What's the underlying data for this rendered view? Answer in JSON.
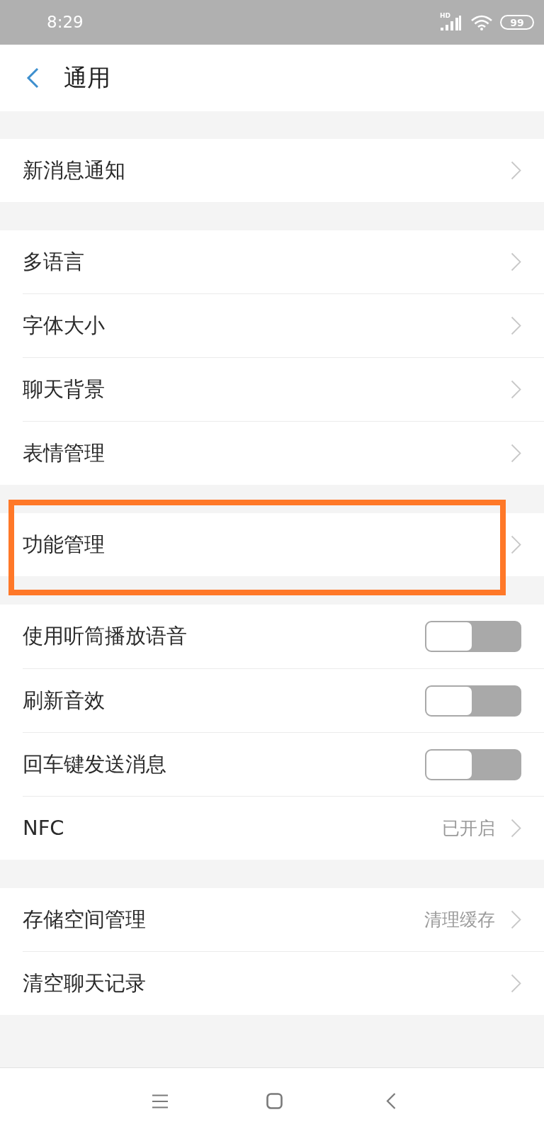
{
  "status_bar": {
    "time": "8:29",
    "network_label": "HD",
    "battery": "99"
  },
  "header": {
    "title": "通用"
  },
  "groups": [
    {
      "items": [
        {
          "kind": "link",
          "label": "新消息通知"
        }
      ]
    },
    {
      "items": [
        {
          "kind": "link",
          "label": "多语言"
        },
        {
          "kind": "link",
          "label": "字体大小"
        },
        {
          "kind": "link",
          "label": "聊天背景"
        },
        {
          "kind": "link",
          "label": "表情管理"
        }
      ]
    },
    {
      "items": [
        {
          "kind": "link",
          "label": "功能管理",
          "highlighted": true
        }
      ]
    },
    {
      "items": [
        {
          "kind": "toggle",
          "label": "使用听筒播放语音",
          "on": false
        },
        {
          "kind": "toggle",
          "label": "刷新音效",
          "on": false
        },
        {
          "kind": "toggle",
          "label": "回车键发送消息",
          "on": false
        },
        {
          "kind": "link",
          "label": "NFC",
          "value": "已开启"
        }
      ]
    },
    {
      "items": [
        {
          "kind": "link",
          "label": "存储空间管理",
          "value": "清理缓存"
        },
        {
          "kind": "link",
          "label": "清空聊天记录"
        }
      ]
    }
  ]
}
